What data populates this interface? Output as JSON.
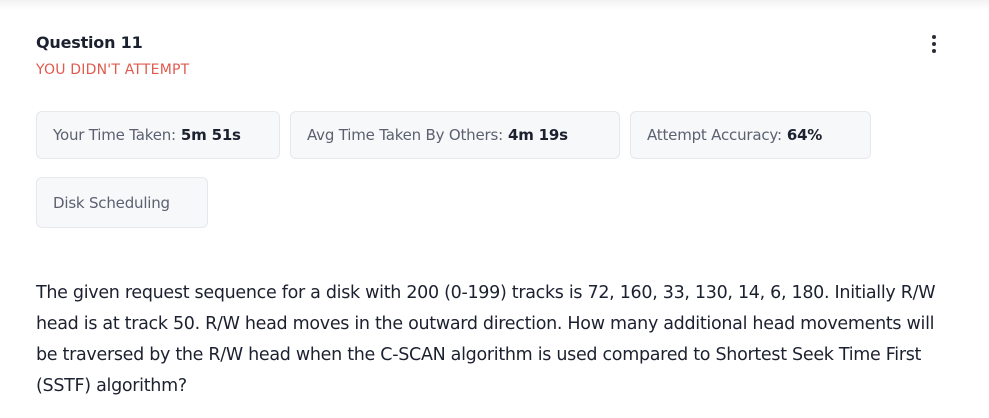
{
  "question": {
    "number_label": "Question 11",
    "status_label": "YOU DIDN'T ATTEMPT",
    "text": "The given request sequence for a disk with 200 (0-199) tracks is 72, 160, 33, 130, 14, 6, 180. Initially R/W head is at track 50. R/W head moves in the outward direction. How many additional head movements will be traversed by the R/W head when the C-SCAN algorithm is used compared to Shortest Seek Time First (SSTF) algorithm?"
  },
  "stats": {
    "time_taken_label": "Your Time Taken:",
    "time_taken_value": "5m 51s",
    "avg_time_label": "Avg Time Taken By Others:",
    "avg_time_value": "4m 19s",
    "accuracy_label": "Attempt Accuracy:",
    "accuracy_value": "64%"
  },
  "topic": {
    "label": "Disk Scheduling"
  },
  "menu": {
    "icon": "more-vertical-icon"
  },
  "colors": {
    "status": "#e05a4e",
    "text": "#1c2130",
    "muted": "#5b6170",
    "chip_bg": "#f7f8fa",
    "chip_border": "#e6e8ec"
  }
}
